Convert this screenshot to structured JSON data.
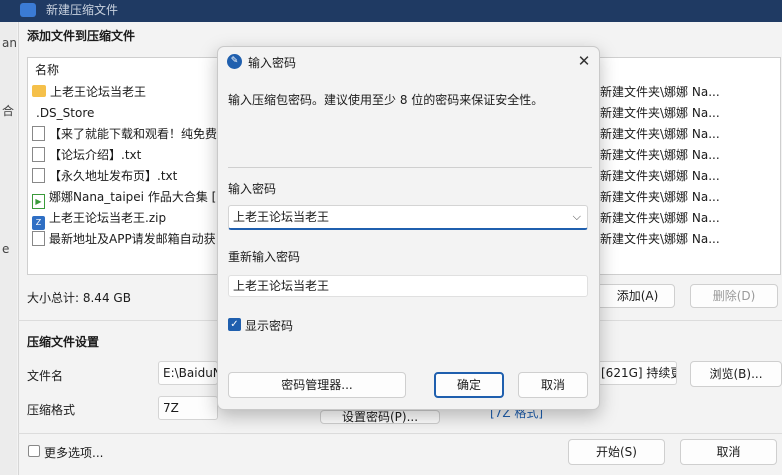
{
  "window": {
    "title": "新建压缩文件"
  },
  "left_strip": {
    "frag1": "an",
    "frag2": "合",
    "frag3": "e"
  },
  "main": {
    "section_title": "添加文件到压缩文件",
    "list_header": "名称",
    "files": [
      {
        "name": "上老王论坛当老王",
        "type": "folder",
        "path": "新建文件夹\\娜娜 Na..."
      },
      {
        "name": ".DS_Store",
        "type": "file",
        "path": "新建文件夹\\娜娜 Na..."
      },
      {
        "name": "【来了就能下载和观看！纯免费",
        "type": "file",
        "path": "新建文件夹\\娜娜 Na..."
      },
      {
        "name": "【论坛介绍】.txt",
        "type": "file",
        "path": "新建文件夹\\娜娜 Na..."
      },
      {
        "name": "【永久地址发布页】.txt",
        "type": "file",
        "path": "新建文件夹\\娜娜 Na..."
      },
      {
        "name": "娜娜Nana_taipei 作品大合集 [",
        "type": "video",
        "path": "新建文件夹\\娜娜 Na..."
      },
      {
        "name": "上老王论坛当老王.zip",
        "type": "zip",
        "path": "新建文件夹\\娜娜 Na..."
      },
      {
        "name": "最新地址及APP请发邮箱自动获",
        "type": "file",
        "path": "新建文件夹\\娜娜 Na..."
      }
    ],
    "total_size": "大小总计: 8.44 GB",
    "add_button": "添加(A)",
    "delete_button": "删除(D)",
    "settings_title": "压缩文件设置",
    "filename_label": "文件名",
    "filename_value": "E:\\BaiduN",
    "filename_suffix": "[621G] 持续更",
    "browse_button": "浏览(B)...",
    "format_label": "压缩格式",
    "format_value": "7Z",
    "set_password_button": "设置密码(P)...",
    "hidden_link": "[7Z 格式]",
    "more_options": "更多选项...",
    "start_button": "开始(S)",
    "cancel_button": "取消"
  },
  "dialog": {
    "title": "输入密码",
    "description": "输入压缩包密码。建议使用至少 8 位的密码来保证安全性。",
    "password_label": "输入密码",
    "password_value": "上老王论坛当老王",
    "confirm_label": "重新输入密码",
    "confirm_value": "上老王论坛当老王",
    "show_password_label": "显示密码",
    "show_password_checked": true,
    "manager_button": "密码管理器...",
    "ok_button": "确定",
    "cancel_button": "取消"
  },
  "colors": {
    "accent": "#1f5fae",
    "title_bar": "#1f3a63",
    "folder": "#f5c04a"
  }
}
